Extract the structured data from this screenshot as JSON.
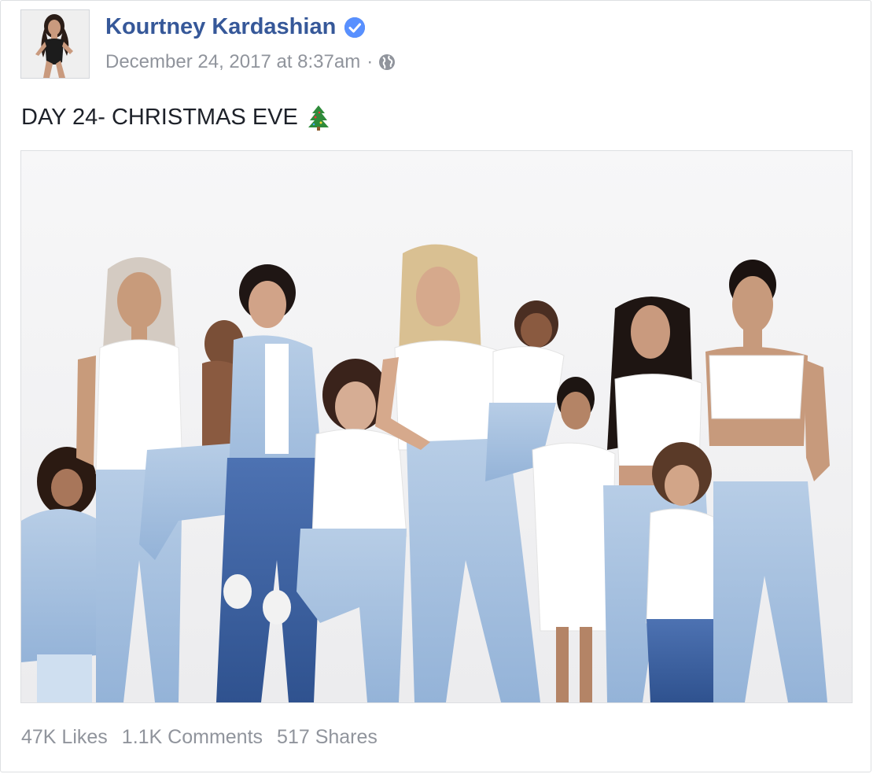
{
  "post": {
    "author": "Kourtney Kardashian",
    "timestamp": "December 24, 2017 at 8:37am",
    "separator": "·",
    "audience_icon": "globe-icon",
    "verified_icon": "verified-badge-icon",
    "caption": "DAY 24- CHRISTMAS EVE",
    "caption_emoji": "christmas-tree-icon"
  },
  "stats": {
    "likes": "47K Likes",
    "comments": "1.1K Comments",
    "shares": "517 Shares"
  },
  "colors": {
    "author_link": "#365899",
    "meta_text": "#90949c",
    "verified_blue": "#4267b2",
    "denim_light": "#a9c4e2",
    "denim_dark": "#3f64a6"
  }
}
